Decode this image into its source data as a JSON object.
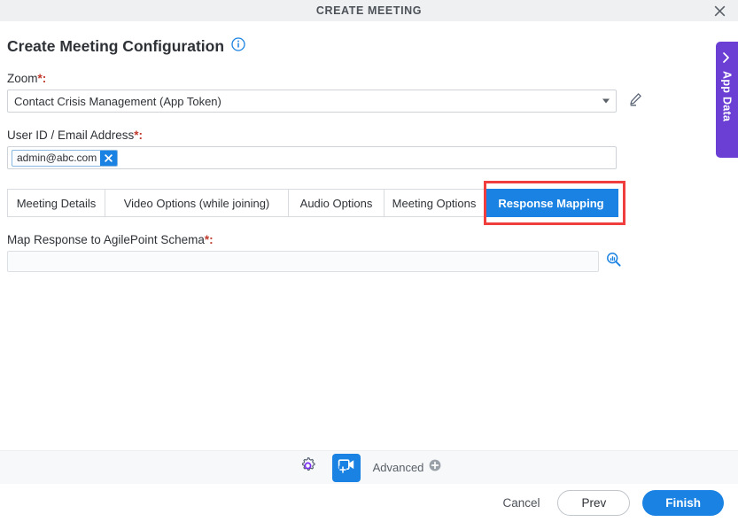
{
  "window": {
    "title": "CREATE MEETING",
    "close_icon": "close-icon"
  },
  "page": {
    "heading": "Create Meeting Configuration",
    "info_icon": "info-circle-icon"
  },
  "fields": {
    "zoom": {
      "label": "Zoom",
      "required_marker": "*:",
      "value": "Contact Crisis Management (App Token)",
      "edit_icon": "pencil-icon",
      "caret_icon": "chevron-down-icon"
    },
    "user_id": {
      "label": "User ID / Email Address",
      "required_marker": "*:",
      "chip_value": "admin@abc.com",
      "chip_remove_icon": "close-icon"
    },
    "schema": {
      "label": "Map Response to AgilePoint Schema",
      "required_marker": "*:",
      "value": "",
      "placeholder": "",
      "picker_icon": "schema-search-icon"
    }
  },
  "tabs": [
    {
      "label": "Meeting Details",
      "active": false
    },
    {
      "label": "Video Options (while joining)",
      "active": false
    },
    {
      "label": "Audio Options",
      "active": false
    },
    {
      "label": "Meeting Options",
      "active": false
    },
    {
      "label": "Response Mapping",
      "active": true
    }
  ],
  "toolbar": {
    "gear_icon": "gear-icon",
    "video_add_icon": "video-add-icon",
    "advanced_label": "Advanced",
    "advanced_add_icon": "plus-circle-icon"
  },
  "footer": {
    "cancel_label": "Cancel",
    "prev_label": "Prev",
    "finish_label": "Finish"
  },
  "app_data_panel": {
    "label": "App Data",
    "collapse_icon": "chevron-left-icon"
  },
  "colors": {
    "accent_blue": "#1a82e2",
    "purple_panel": "#6b3fd4",
    "highlight_red": "#f03d3d",
    "required_red": "#c0392b",
    "titlebar_gray": "#eff0f2",
    "toolbar_gray": "#f7f8fa"
  }
}
